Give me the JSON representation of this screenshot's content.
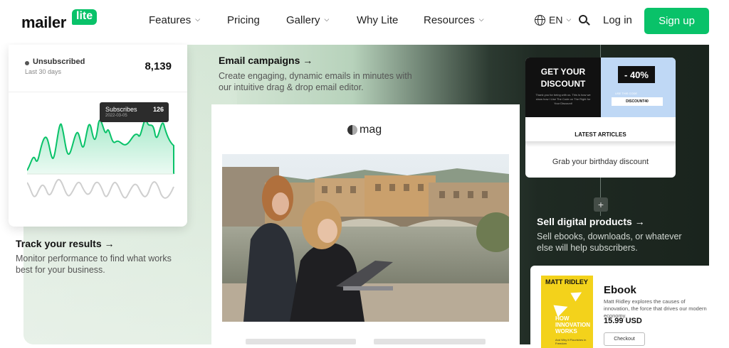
{
  "header": {
    "logo_text": "mailer",
    "logo_bubble": "lite",
    "nav": [
      {
        "label": "Features",
        "dropdown": true
      },
      {
        "label": "Pricing",
        "dropdown": false
      },
      {
        "label": "Gallery",
        "dropdown": true
      },
      {
        "label": "Why Lite",
        "dropdown": false
      },
      {
        "label": "Resources",
        "dropdown": true
      }
    ],
    "language": "EN",
    "login_label": "Log in",
    "signup_label": "Sign up"
  },
  "stats_card": {
    "label": "Unsubscribed",
    "period": "Last 30 days",
    "value": "8,139",
    "tooltip": {
      "label": "Subscribes",
      "value": "126",
      "date": "2022-03-05"
    }
  },
  "features": {
    "track": {
      "title": "Track your results →",
      "desc": "Monitor performance to find what works best for your business."
    },
    "email": {
      "title": "Email campaigns →",
      "desc": "Create engaging, dynamic emails in minutes with our intuitive drag & drop email editor."
    },
    "sell": {
      "title": "Sell digital products →",
      "desc": "Sell ebooks, downloads, or whatever else will help subscribers."
    }
  },
  "email_preview": {
    "brand": "mag"
  },
  "discount_card": {
    "headline": "GET YOUR DISCOUNT",
    "fine_print": "Thank you for being with us. This is how we show how I Use The Code on The Right for Your Discount!",
    "badge": "- 40%",
    "code_label": "USE THIS CODE",
    "code": "DISCOUNT40",
    "articles_heading": "LATEST ARTICLES",
    "caption": "Grab your birthday discount"
  },
  "ebook_card": {
    "book_author": "MATT RIDLEY",
    "book_title": "HOW INNOVATION WORKS",
    "book_subtitle": "And Why It Flourishes in Freedom",
    "title": "Ebook",
    "desc": "Matt Ridley explores the causes of innovation, the force that drives our modern economy.",
    "price": "15.99 USD",
    "checkout_label": "Checkout"
  },
  "colors": {
    "brand_green": "#09c269",
    "dark_panel": "#1a241d",
    "tooltip_bg": "#2c2c2c"
  },
  "icons": [
    "globe-icon",
    "search-icon",
    "chevron-down-icon",
    "plus-icon",
    "arrow-right-icon"
  ]
}
